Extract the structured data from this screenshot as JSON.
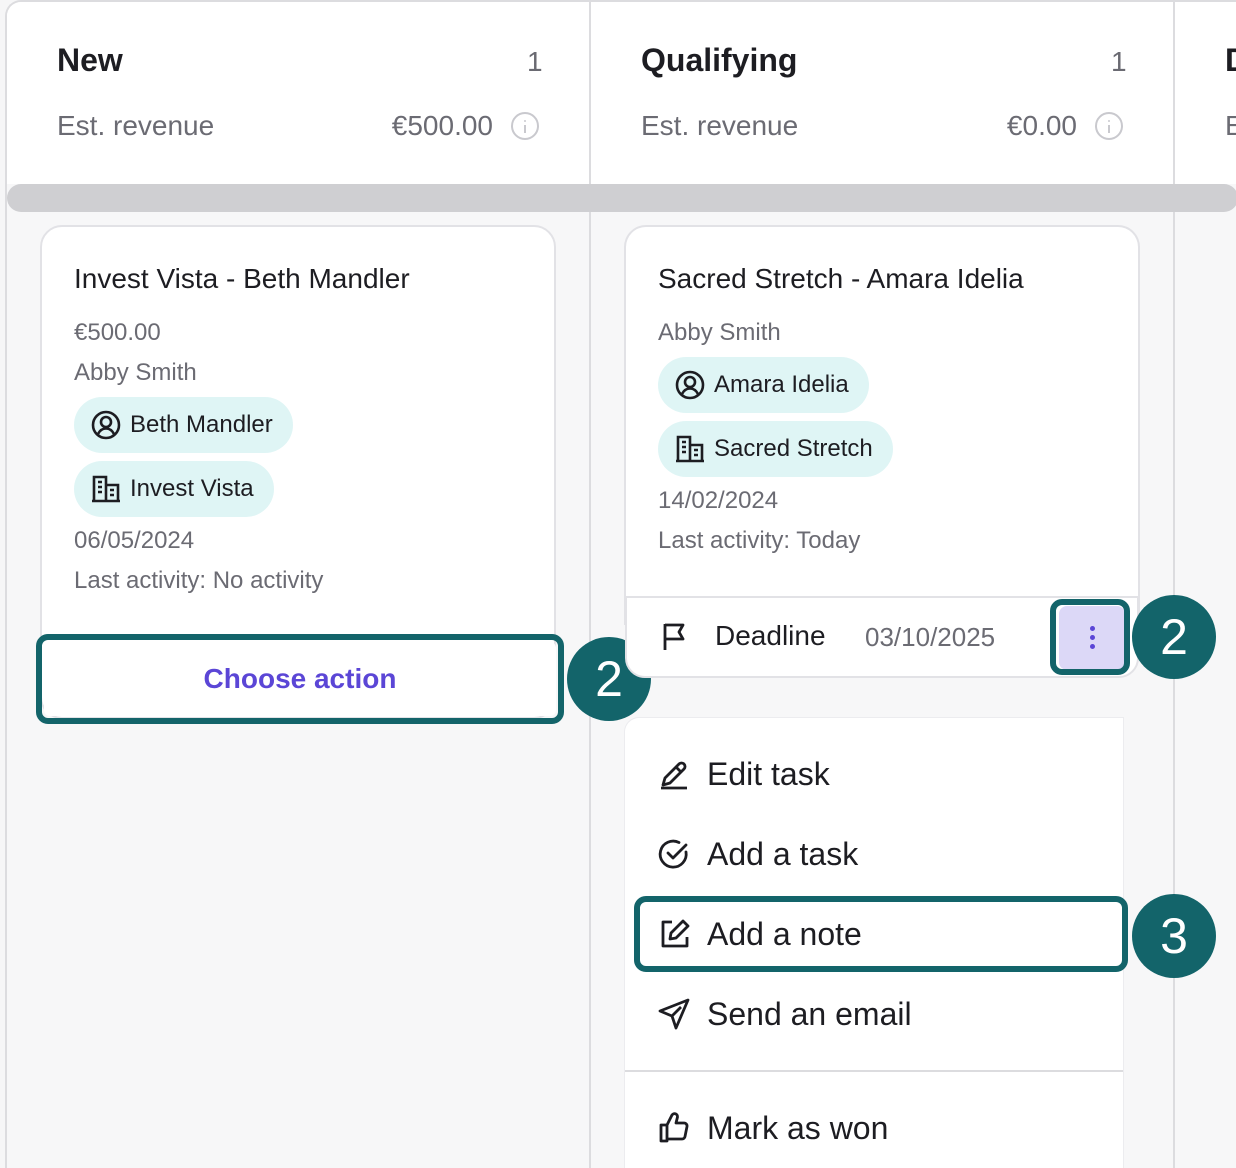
{
  "columns": [
    {
      "title": "New",
      "count": "1",
      "revenue_label": "Est. revenue",
      "revenue_value": "€500.00"
    },
    {
      "title": "Qualifying",
      "count": "1",
      "revenue_label": "Est. revenue",
      "revenue_value": "€0.00"
    },
    {
      "title": "D",
      "revenue_label": "E"
    }
  ],
  "card1": {
    "title": "Invest Vista - Beth Mandler",
    "amount": "€500.00",
    "owner": "Abby Smith",
    "contact_chip": "Beth Mandler",
    "company_chip": "Invest Vista",
    "date": "06/05/2024",
    "last_activity": "Last activity: No activity",
    "action_button": "Choose action"
  },
  "card2": {
    "title": "Sacred Stretch - Amara Idelia",
    "owner": "Abby Smith",
    "contact_chip": "Amara Idelia",
    "company_chip": "Sacred Stretch",
    "date": "14/02/2024",
    "last_activity": "Last activity: Today",
    "task_label": "Deadline",
    "task_date": "03/10/2025"
  },
  "menu": {
    "items": [
      "Edit task",
      "Add a task",
      "Add a note",
      "Send an email",
      "Mark as won"
    ]
  },
  "annotations": {
    "step_a": "2",
    "step_b": "2",
    "step_c": "3"
  },
  "colors": {
    "accent": "#13646a",
    "chip_bg": "#dff5f5",
    "button_text": "#5b46d6",
    "kebab_bg": "#dcd8f7"
  },
  "icons": [
    "info-icon",
    "contact-icon",
    "company-icon",
    "flag-icon",
    "kebab-icon",
    "pencil-icon",
    "check-circle-icon",
    "edit-note-icon",
    "send-icon",
    "thumbs-up-icon"
  ]
}
